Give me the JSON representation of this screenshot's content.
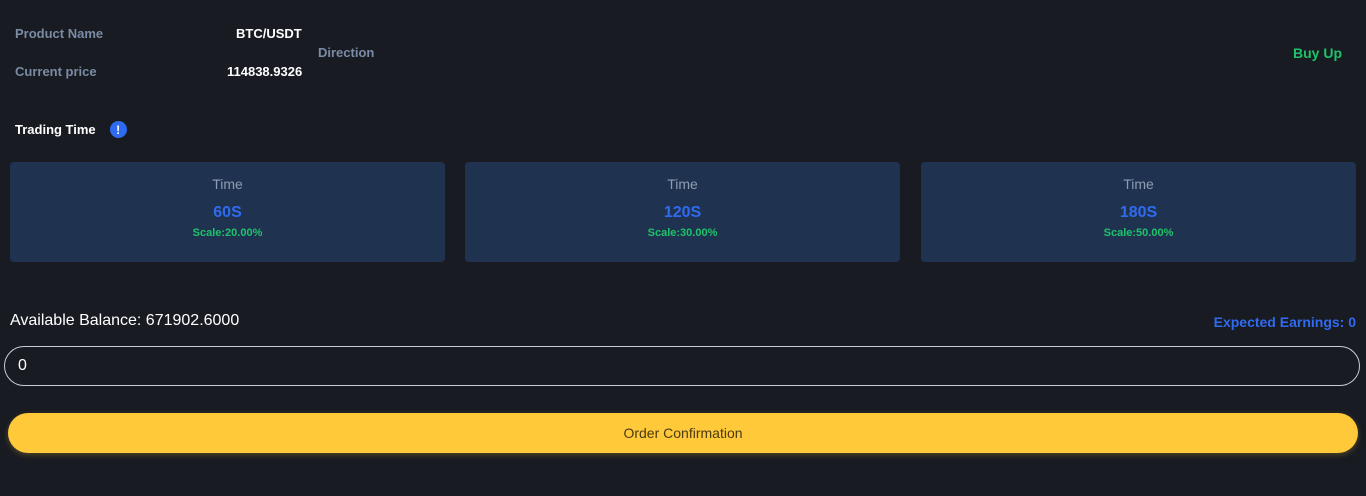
{
  "product": {
    "name_label": "Product Name",
    "name_value": "BTC/USDT",
    "price_label": "Current price",
    "price_value": "114838.9326",
    "direction_label": "Direction",
    "direction_value": "Buy Up"
  },
  "trading_time": {
    "label": "Trading Time",
    "info_icon": "!"
  },
  "time_options": [
    {
      "label": "Time",
      "value": "60S",
      "scale": "Scale:20.00%"
    },
    {
      "label": "Time",
      "value": "120S",
      "scale": "Scale:30.00%"
    },
    {
      "label": "Time",
      "value": "180S",
      "scale": "Scale:50.00%"
    }
  ],
  "balance": {
    "text": "Available Balance: 671902.6000",
    "expected": "Expected Earnings: 0"
  },
  "amount": {
    "value": "0"
  },
  "confirm": {
    "label": "Order Confirmation"
  },
  "colors": {
    "background": "#181b22",
    "card": "#1f3350",
    "accent_blue": "#2f6bf0",
    "accent_green": "#1ec26a",
    "button": "#ffc93a"
  }
}
